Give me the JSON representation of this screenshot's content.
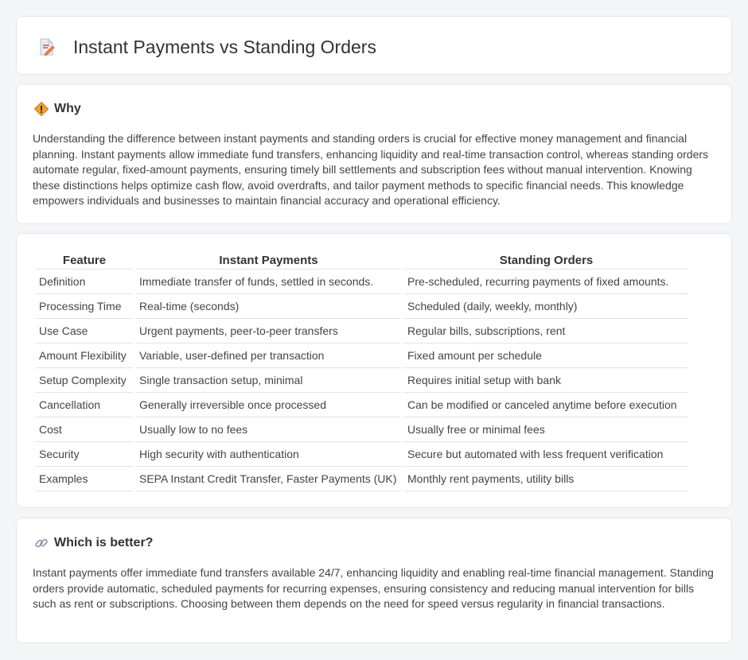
{
  "page": {
    "title": "Instant Payments vs Standing Orders",
    "title_icon": "document-pencil-icon"
  },
  "why": {
    "heading": "Why",
    "icon": "diamond-sign-icon",
    "text": "Understanding the difference between instant payments and standing orders is crucial for effective money management and financial planning. Instant payments allow immediate fund transfers, enhancing liquidity and real-time transaction control, whereas standing orders automate regular, fixed-amount payments, ensuring timely bill settlements and subscription fees without manual intervention. Knowing these distinctions helps optimize cash flow, avoid overdrafts, and tailor payment methods to specific financial needs. This knowledge empowers individuals and businesses to maintain financial accuracy and operational efficiency."
  },
  "table": {
    "headers": [
      "Feature",
      "Instant Payments",
      "Standing Orders"
    ],
    "rows": [
      [
        "Definition",
        "Immediate transfer of funds, settled in seconds.",
        "Pre-scheduled, recurring payments of fixed amounts."
      ],
      [
        "Processing Time",
        "Real-time (seconds)",
        "Scheduled (daily, weekly, monthly)"
      ],
      [
        "Use Case",
        "Urgent payments, peer-to-peer transfers",
        "Regular bills, subscriptions, rent"
      ],
      [
        "Amount Flexibility",
        "Variable, user-defined per transaction",
        "Fixed amount per schedule"
      ],
      [
        "Setup Complexity",
        "Single transaction setup, minimal",
        "Requires initial setup with bank"
      ],
      [
        "Cancellation",
        "Generally irreversible once processed",
        "Can be modified or canceled anytime before execution"
      ],
      [
        "Cost",
        "Usually low to no fees",
        "Usually free or minimal fees"
      ],
      [
        "Security",
        "High security with authentication",
        "Secure but automated with less frequent verification"
      ],
      [
        "Examples",
        "SEPA Instant Credit Transfer, Faster Payments (UK)",
        "Monthly rent payments, utility bills"
      ]
    ]
  },
  "better": {
    "heading": "Which is better?",
    "icon": "link-icon",
    "text": "Instant payments offer immediate fund transfers available 24/7, enhancing liquidity and enabling real-time financial management. Standing orders provide automatic, scheduled payments for recurring expenses, ensuring consistency and reducing manual intervention for bills such as rent or subscriptions. Choosing between them depends on the need for speed versus regularity in financial transactions."
  },
  "colors": {
    "background": "#f4f5f7",
    "card": "#ffffff",
    "accent": "#f0a030"
  }
}
